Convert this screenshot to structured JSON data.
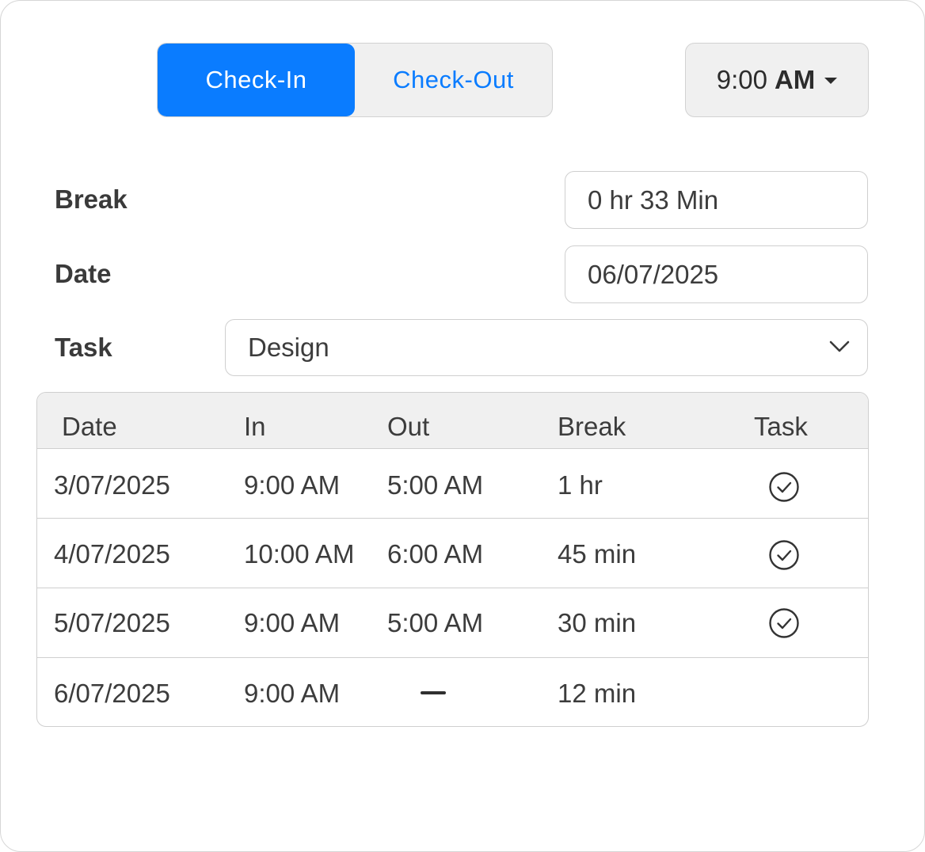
{
  "mode_toggle": {
    "check_in_label": "Check-In",
    "check_out_label": "Check-Out",
    "active": "check_in"
  },
  "time_select": {
    "hour": "9:00",
    "period": "AM",
    "icon": "caret-down-icon"
  },
  "form": {
    "break_label": "Break",
    "break_value": "0 hr 33 Min",
    "date_label": "Date",
    "date_value": "06/07/2025",
    "task_label": "Task",
    "task_value": "Design",
    "task_icon": "chevron-down-icon"
  },
  "table": {
    "headers": {
      "date": "Date",
      "in": "In",
      "out": "Out",
      "break": "Break",
      "task": "Task"
    },
    "rows": [
      {
        "date": "3/07/2025",
        "in": "9:00 AM",
        "out": "5:00 AM",
        "break": "1 hr",
        "task_done": true
      },
      {
        "date": "4/07/2025",
        "in": "10:00 AM",
        "out": "6:00 AM",
        "break": "45 min",
        "task_done": true
      },
      {
        "date": "5/07/2025",
        "in": "9:00 AM",
        "out": "5:00 AM",
        "break": "30 min",
        "task_done": true
      },
      {
        "date": "6/07/2025",
        "in": "9:00 AM",
        "out": null,
        "break": "12 min",
        "task_done": false
      }
    ]
  },
  "colors": {
    "accent": "#0a7cff",
    "control_bg": "#f0f0f0",
    "border": "#cfcfcf",
    "text": "#3c3c3c"
  }
}
